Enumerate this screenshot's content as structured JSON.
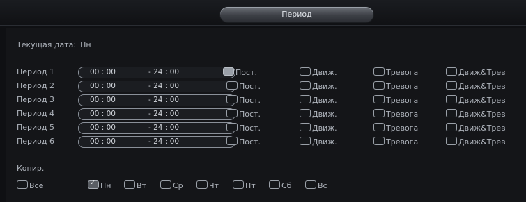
{
  "window": {
    "title": "Период"
  },
  "current_date": {
    "label": "Текущая дата:",
    "value": "Пн"
  },
  "periods": [
    {
      "label": "Период 1",
      "start": "00 : 00",
      "end": "- 24 : 00"
    },
    {
      "label": "Период 2",
      "start": "00 : 00",
      "end": "- 24 : 00"
    },
    {
      "label": "Период 3",
      "start": "00 : 00",
      "end": "- 24 : 00"
    },
    {
      "label": "Период 4",
      "start": "00 : 00",
      "end": "- 24 : 00"
    },
    {
      "label": "Период 5",
      "start": "00 : 00",
      "end": "- 24 : 00"
    },
    {
      "label": "Период 6",
      "start": "00 : 00",
      "end": "- 24 : 00"
    }
  ],
  "options": {
    "post": "Пост.",
    "motion": "Движ.",
    "alarm": "Тревога",
    "motion_alarm": "Движ&Трев"
  },
  "copy": {
    "label": "Копир.",
    "all": "Все",
    "days": [
      "Пн",
      "Вт",
      "Ср",
      "Чт",
      "Пт",
      "Сб",
      "Вс"
    ],
    "checked_day": "Пн"
  }
}
